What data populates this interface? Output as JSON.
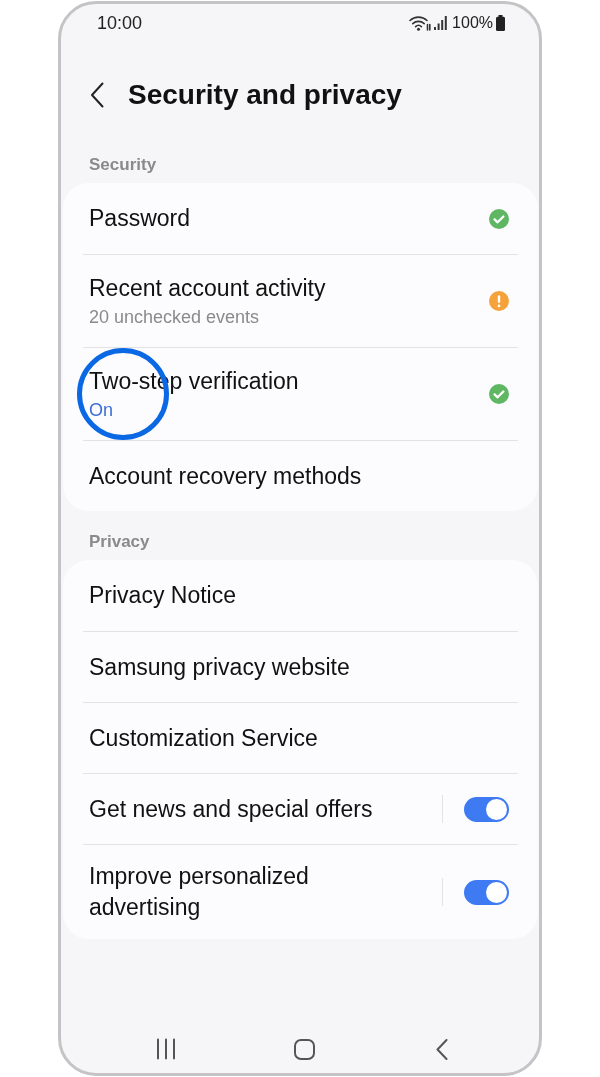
{
  "status_bar": {
    "time": "10:00",
    "battery": "100%"
  },
  "header": {
    "title": "Security and privacy"
  },
  "sections": [
    {
      "label": "Security",
      "items": [
        {
          "kind": "status",
          "title": "Password",
          "needs_attention": false
        },
        {
          "kind": "status",
          "title": "Recent account activity",
          "subtitle": "20 unchecked events",
          "subtitle_accent": false,
          "needs_attention": true
        },
        {
          "kind": "status",
          "title": "Two-step verification",
          "subtitle": "On",
          "subtitle_accent": true,
          "needs_attention": false,
          "highlighted": true
        },
        {
          "kind": "link",
          "title": "Account recovery methods"
        }
      ]
    },
    {
      "label": "Privacy",
      "items": [
        {
          "kind": "link",
          "title": "Privacy Notice"
        },
        {
          "kind": "link",
          "title": "Samsung privacy website"
        },
        {
          "kind": "link",
          "title": "Customization Service"
        },
        {
          "kind": "toggle",
          "title": "Get news and special offers",
          "on": true
        },
        {
          "kind": "toggle",
          "title": "Improve personalized advertising",
          "on": true
        }
      ]
    }
  ]
}
